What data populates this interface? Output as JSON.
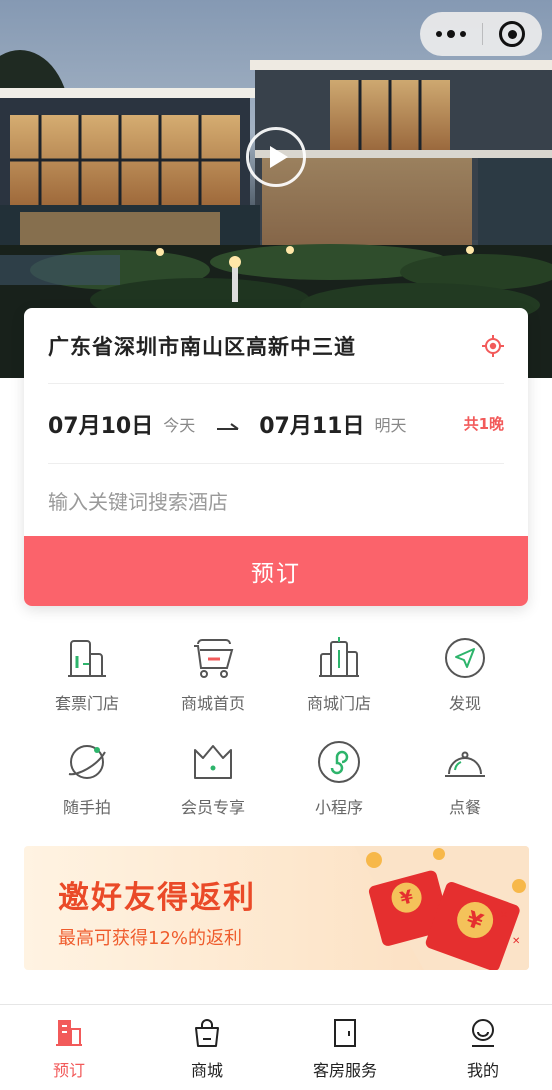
{
  "hero": {
    "play_icon": "play-icon",
    "capsule": {
      "more_icon": "more-dots-icon",
      "close_icon": "target-close-icon"
    }
  },
  "booking": {
    "address": "广东省深圳市南山区高新中三道",
    "location_icon": "locate-icon",
    "checkin_date": "07月10日",
    "checkin_day": "今天",
    "checkout_date": "07月11日",
    "checkout_day": "明天",
    "nights": "共1晚",
    "search_placeholder": "输入关键词搜索酒店",
    "book_label": "预订",
    "accent_color": "#fb636b"
  },
  "grid": {
    "items": [
      {
        "label": "套票门店",
        "icon": "building-store-icon"
      },
      {
        "label": "商城首页",
        "icon": "basket-icon"
      },
      {
        "label": "商城门店",
        "icon": "city-buildings-icon"
      },
      {
        "label": "发现",
        "icon": "compass-icon"
      },
      {
        "label": "随手拍",
        "icon": "planet-icon"
      },
      {
        "label": "会员专享",
        "icon": "crown-icon"
      },
      {
        "label": "小程序",
        "icon": "mini-program-icon"
      },
      {
        "label": "点餐",
        "icon": "dish-cloche-icon"
      }
    ]
  },
  "banner": {
    "title": "邀好友得返利",
    "subtitle": "最高可获得12%的返利",
    "image": "red-envelope-icon"
  },
  "tabbar": {
    "tabs": [
      {
        "label": "预订",
        "icon": "hotel-icon",
        "active": true
      },
      {
        "label": "商城",
        "icon": "shopping-bag-icon",
        "active": false
      },
      {
        "label": "客房服务",
        "icon": "door-icon",
        "active": false
      },
      {
        "label": "我的",
        "icon": "user-icon",
        "active": false
      }
    ]
  }
}
